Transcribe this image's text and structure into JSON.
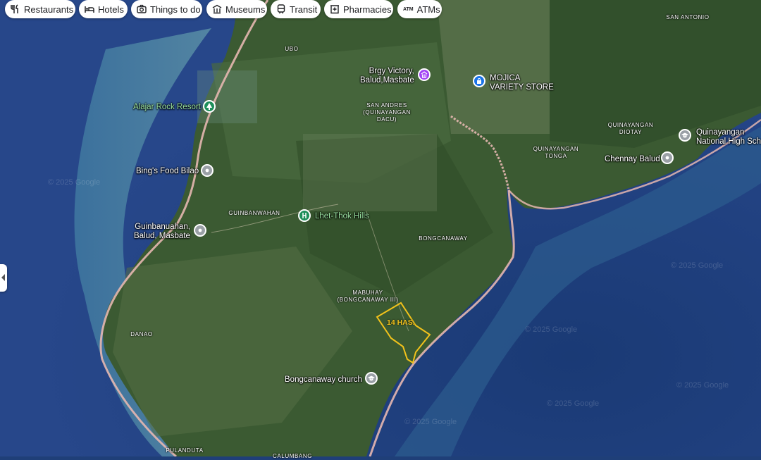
{
  "chips": [
    {
      "label": "Restaurants",
      "icon": "fork-knife-icon"
    },
    {
      "label": "Hotels",
      "icon": "bed-icon"
    },
    {
      "label": "Things to do",
      "icon": "camera-icon"
    },
    {
      "label": "Museums",
      "icon": "museum-icon"
    },
    {
      "label": "Transit",
      "icon": "train-icon"
    },
    {
      "label": "Pharmacies",
      "icon": "pharmacy-icon"
    },
    {
      "label": "ATMs",
      "icon": "atm-icon"
    }
  ],
  "pois": {
    "alajar": "Alajar Rock Resort",
    "bings": "Bing's Food Bilao",
    "guinbanuahan_1": "Guinbanuahan,",
    "guinbanuahan_2": "Balud, Masbate",
    "lhet": "Lhet-Thok Hills",
    "brgy_1": "Brgy Victory,",
    "brgy_2": "Balud,Masbate",
    "mojica_1": "MOJICA",
    "mojica_2": "VARIETY STORE",
    "quinayangan_hs_1": "Quinayangan",
    "quinayangan_hs_2": "National High Scho",
    "chennay": "Chennay Balud",
    "church": "Bongcanaway church"
  },
  "places": {
    "ubo": "UBO",
    "san_antonio": "SAN ANTONIO",
    "san_andres_1": "SAN ANDRES",
    "san_andres_2": "(QUINAYANGAN",
    "san_andres_3": "DACU)",
    "quin_diotay_1": "QUINAYANGAN",
    "quin_diotay_2": "DIOTAY",
    "quin_tonga_1": "QUINAYANGAN",
    "quin_tonga_2": "TONGA",
    "guinbanwahan": "GUINBANWAHAN",
    "bongcanaway": "BONGCANAWAY",
    "mabuhay_1": "MABUHAY",
    "mabuhay_2": "(BONGCANAWAY III)",
    "danao": "DANAO",
    "pulanduta": "PULANDUTA",
    "calumbang": "CALUMBANG"
  },
  "area_label": "14 HAS.",
  "watermark": "© 2025 Google",
  "colors": {
    "sea": "#1f3f78",
    "land": "#3b5a32",
    "boundary": "#f2c21b",
    "poi_green": "#1e8e5a",
    "poi_gray": "#9aa0a6",
    "poi_purple": "#a142f4",
    "poi_blue": "#1a73e8"
  }
}
